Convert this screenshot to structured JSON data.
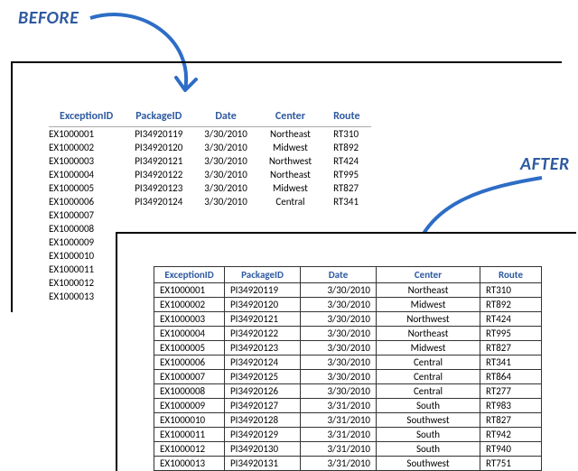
{
  "labels": {
    "before": "BEFORE",
    "after": "AFTER"
  },
  "columns": {
    "exception": "ExceptionID",
    "package": "PackageID",
    "date": "Date",
    "center": "Center",
    "route": "Route"
  },
  "before_rows": [
    {
      "exception": "EX1000001",
      "package": "PI34920119",
      "date": "3/30/2010",
      "center": "Northeast",
      "route": "RT310"
    },
    {
      "exception": "EX1000002",
      "package": "PI34920120",
      "date": "3/30/2010",
      "center": "Midwest",
      "route": "RT892"
    },
    {
      "exception": "EX1000003",
      "package": "PI34920121",
      "date": "3/30/2010",
      "center": "Northwest",
      "route": "RT424"
    },
    {
      "exception": "EX1000004",
      "package": "PI34920122",
      "date": "3/30/2010",
      "center": "Northeast",
      "route": "RT995"
    },
    {
      "exception": "EX1000005",
      "package": "PI34920123",
      "date": "3/30/2010",
      "center": "Midwest",
      "route": "RT827"
    },
    {
      "exception": "EX1000006",
      "package": "PI34920124",
      "date": "3/30/2010",
      "center": "Central",
      "route": "RT341"
    },
    {
      "exception": "EX1000007",
      "package": "",
      "date": "",
      "center": "",
      "route": ""
    },
    {
      "exception": "EX1000008",
      "package": "",
      "date": "",
      "center": "",
      "route": ""
    },
    {
      "exception": "EX1000009",
      "package": "",
      "date": "",
      "center": "",
      "route": ""
    },
    {
      "exception": "EX1000010",
      "package": "",
      "date": "",
      "center": "",
      "route": ""
    },
    {
      "exception": "EX1000011",
      "package": "",
      "date": "",
      "center": "",
      "route": ""
    },
    {
      "exception": "EX1000012",
      "package": "",
      "date": "",
      "center": "",
      "route": ""
    },
    {
      "exception": "EX1000013",
      "package": "",
      "date": "",
      "center": "",
      "route": ""
    }
  ],
  "after_rows": [
    {
      "exception": "EX1000001",
      "package": "PI34920119",
      "date": "3/30/2010",
      "center": "Northeast",
      "route": "RT310"
    },
    {
      "exception": "EX1000002",
      "package": "PI34920120",
      "date": "3/30/2010",
      "center": "Midwest",
      "route": "RT892"
    },
    {
      "exception": "EX1000003",
      "package": "PI34920121",
      "date": "3/30/2010",
      "center": "Northwest",
      "route": "RT424"
    },
    {
      "exception": "EX1000004",
      "package": "PI34920122",
      "date": "3/30/2010",
      "center": "Northeast",
      "route": "RT995"
    },
    {
      "exception": "EX1000005",
      "package": "PI34920123",
      "date": "3/30/2010",
      "center": "Midwest",
      "route": "RT827"
    },
    {
      "exception": "EX1000006",
      "package": "PI34920124",
      "date": "3/30/2010",
      "center": "Central",
      "route": "RT341"
    },
    {
      "exception": "EX1000007",
      "package": "PI34920125",
      "date": "3/30/2010",
      "center": "Central",
      "route": "RT864"
    },
    {
      "exception": "EX1000008",
      "package": "PI34920126",
      "date": "3/30/2010",
      "center": "Central",
      "route": "RT277"
    },
    {
      "exception": "EX1000009",
      "package": "PI34920127",
      "date": "3/31/2010",
      "center": "South",
      "route": "RT983"
    },
    {
      "exception": "EX1000010",
      "package": "PI34920128",
      "date": "3/31/2010",
      "center": "Southwest",
      "route": "RT827"
    },
    {
      "exception": "EX1000011",
      "package": "PI34920129",
      "date": "3/31/2010",
      "center": "South",
      "route": "RT942"
    },
    {
      "exception": "EX1000012",
      "package": "PI34920130",
      "date": "3/31/2010",
      "center": "South",
      "route": "RT940"
    },
    {
      "exception": "EX1000013",
      "package": "PI34920131",
      "date": "3/31/2010",
      "center": "Southwest",
      "route": "RT751"
    }
  ],
  "colors": {
    "accent": "#2E5AA0",
    "arrow": "#2D6DC6"
  }
}
